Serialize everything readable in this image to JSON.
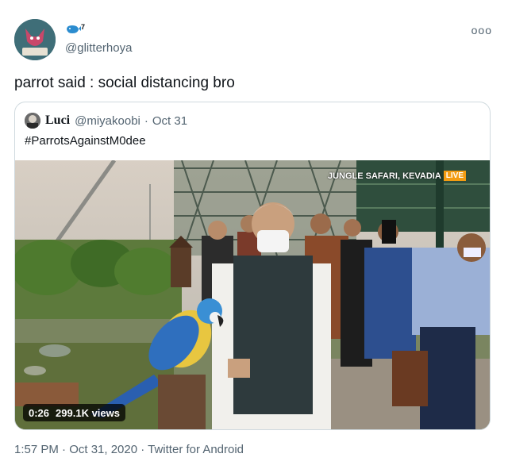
{
  "author": {
    "handle": "@glitterhoya",
    "name_emoji": "whale-icon",
    "superscript": "7"
  },
  "menu": {
    "more_label": "ooo"
  },
  "tweet": {
    "text": "parrot said : social distancing bro"
  },
  "quote": {
    "name": "Luci",
    "handle": "@miyakoobi",
    "separator": "·",
    "date": "Oct 31",
    "text": "#ParrotsAgainstM0dee",
    "video": {
      "time": "0:26",
      "views": "299.1K views",
      "channel": "JUNGLE SAFARI, KEVADIA",
      "live": "LIVE"
    }
  },
  "footer": {
    "text": "1:57 PM · Oct 31, 2020 · Twitter for Android"
  },
  "colors": {
    "secondary_text": "#536471",
    "border": "#cfd9de",
    "live_badge": "#f39c12"
  }
}
